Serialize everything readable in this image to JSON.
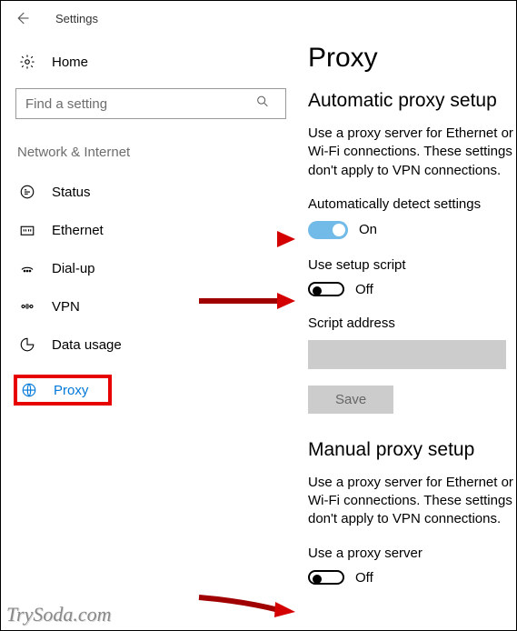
{
  "header": {
    "title": "Settings"
  },
  "sidebar": {
    "home": "Home",
    "search_placeholder": "Find a setting",
    "category": "Network & Internet",
    "items": [
      {
        "label": "Status"
      },
      {
        "label": "Ethernet"
      },
      {
        "label": "Dial-up"
      },
      {
        "label": "VPN"
      },
      {
        "label": "Data usage"
      },
      {
        "label": "Proxy"
      }
    ]
  },
  "page": {
    "title": "Proxy",
    "auto": {
      "heading": "Automatic proxy setup",
      "desc": "Use a proxy server for Ethernet or Wi-Fi connections. These settings don't apply to VPN connections.",
      "detect_label": "Automatically detect settings",
      "detect_state": "On",
      "script_label": "Use setup script",
      "script_state": "Off",
      "script_addr_label": "Script address",
      "save": "Save"
    },
    "manual": {
      "heading": "Manual proxy setup",
      "desc": "Use a proxy server for Ethernet or Wi-Fi connections. These settings don't apply to VPN connections.",
      "use_label": "Use a proxy server",
      "use_state": "Off"
    }
  },
  "watermark": "TrySoda.com"
}
